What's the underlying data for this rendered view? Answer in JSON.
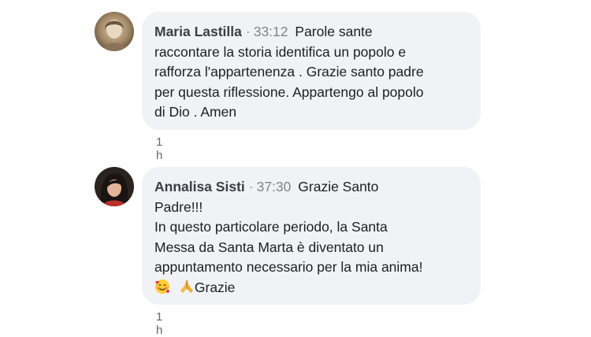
{
  "comments": [
    {
      "author": "Maria Lastilla",
      "separator": "·",
      "timestamp": "33:12",
      "text_lines": [
        "Parole sante",
        "raccontare la storia identifica un popolo e",
        "rafforza l'appartenenza .  Grazie santo padre",
        "per questa riflessione. Appartengo al popolo",
        "di Dio . Amen"
      ],
      "time_ago": "1 h",
      "avatar_icon": "profile-photo"
    },
    {
      "author": "Annalisa Sisti",
      "separator": "·",
      "timestamp": "37:30",
      "text_lines": [
        "Grazie Santo",
        "Padre!!!",
        "In questo particolare periodo, la Santa",
        "Messa da Santa Marta è diventato un",
        "appuntamento necessario per la mia anima!"
      ],
      "last_line_text": "Grazie",
      "emojis": [
        "smiling-face-with-hearts",
        "folded-hands"
      ],
      "time_ago": "1 h",
      "avatar_icon": "profile-photo"
    }
  ],
  "colors": {
    "bubble_bg": "#f0f2f5",
    "author": "#3b3f45",
    "meta": "#65676b"
  }
}
